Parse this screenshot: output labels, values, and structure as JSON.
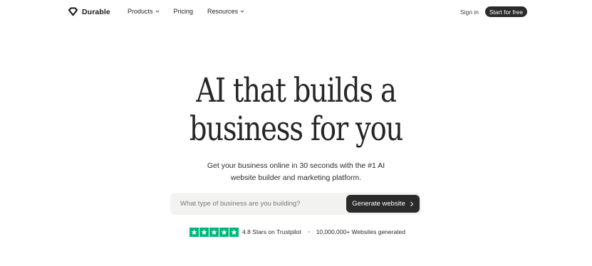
{
  "nav": {
    "brand": "Durable",
    "logo_icon": "diamond-logo-icon",
    "menu": [
      {
        "label": "Products",
        "has_dropdown": true
      },
      {
        "label": "Pricing",
        "has_dropdown": false
      },
      {
        "label": "Resources",
        "has_dropdown": true
      }
    ],
    "sign_in": "Sign in",
    "cta": "Start for free"
  },
  "hero": {
    "headline_line1": "AI that builds a",
    "headline_line2": "business for you",
    "subtitle_line1": "Get your business online in 30 seconds with the #1 AI",
    "subtitle_line2": "website builder and marketing platform."
  },
  "search": {
    "placeholder": "What type of business are you building?",
    "value": "",
    "button_label": "Generate website",
    "button_icon": "chevron-right-icon"
  },
  "trust": {
    "stars": 5,
    "rating_text": "4.8 Stars on Trustpilot",
    "websites_text": "10,000,000+ Websites generated"
  },
  "colors": {
    "background": "#ffffff",
    "dark_button": "#2b2b2b",
    "input_background": "#f2f2f1",
    "trustpilot_green": "#00b67a"
  }
}
